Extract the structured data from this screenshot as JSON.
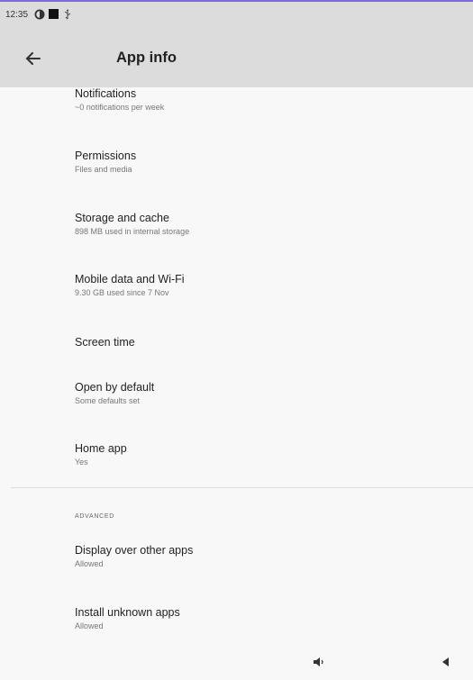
{
  "status_bar": {
    "time": "12:35",
    "icons": [
      "contrast-icon",
      "square-icon",
      "usb-icon"
    ]
  },
  "app_bar": {
    "title": "App info",
    "back_icon": "arrow-back-icon"
  },
  "settings": [
    {
      "title": "Notifications",
      "subtitle": "~0 notifications per week"
    },
    {
      "title": "Permissions",
      "subtitle": "Files and media"
    },
    {
      "title": "Storage and cache",
      "subtitle": "898 MB used in internal storage"
    },
    {
      "title": "Mobile data and Wi-Fi",
      "subtitle": "9.30 GB used since 7 Nov"
    },
    {
      "title": "Screen time",
      "subtitle": ""
    },
    {
      "title": "Open by default",
      "subtitle": "Some defaults set"
    },
    {
      "title": "Home app",
      "subtitle": "Yes"
    }
  ],
  "advanced": {
    "header": "ADVANCED",
    "items": [
      {
        "title": "Display over other apps",
        "subtitle": "Allowed"
      },
      {
        "title": "Install unknown apps",
        "subtitle": "Allowed"
      }
    ]
  },
  "nav_bar": {
    "icons": [
      "volume-icon",
      "back-triangle-icon"
    ]
  },
  "colors": {
    "status_bar": "#dcdcdc",
    "app_bar": "#dcdcdc",
    "background": "#f8f8f8",
    "accent_line": "#7b6bd6",
    "divider": "#d9e0dc"
  }
}
